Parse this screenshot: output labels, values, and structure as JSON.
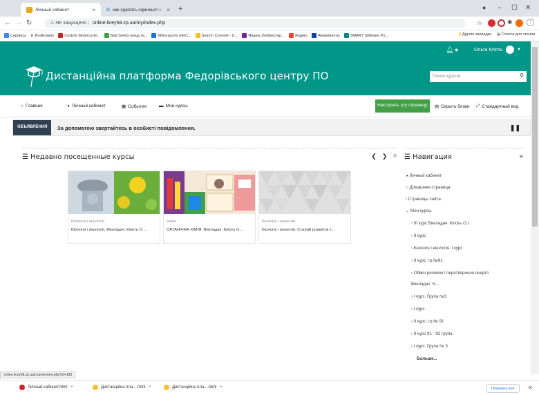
{
  "browser": {
    "tabs": [
      {
        "title": "Личный кабинет",
        "favicon_color": "#e5a823"
      },
      {
        "title": "как сделать скриншот на компь",
        "favicon_color": "#4285f4"
      }
    ],
    "address": {
      "security_label": "Не защищено",
      "url": "online.licey58.zp.ua/my/index.php"
    },
    "bookmarks": [
      {
        "label": "Сервисы",
        "color": "#4285f4"
      },
      {
        "label": "Bookmarks",
        "color": "#1e5bd6"
      },
      {
        "label": "Custom Motorcycle...",
        "color": "#c62828"
      },
      {
        "label": "Bad Seeds предста...",
        "color": "#43a047"
      },
      {
        "label": "Motorsports InfoC...",
        "color": "#1976d2"
      },
      {
        "label": "Search Console - C...",
        "color": "#fbc02d"
      },
      {
        "label": "Яндекс.Вебмастер...",
        "color": "#7b1fa2"
      },
      {
        "label": "Яндекс",
        "color": "#f44336"
      },
      {
        "label": "Авиабилеты",
        "color": "#0d47a1"
      },
      {
        "label": "SMART Software Po...",
        "color": "#00897b"
      }
    ],
    "bookmarks_right": [
      "Другие закладки",
      "Список для чтения"
    ],
    "status_url": "online.licey58.zp.ua/course/view.php?id=183",
    "downloads": [
      "Личный кабинет.html",
      "Дистанційна пла....html",
      "Дистанційна пла....html"
    ],
    "show_all_label": "Показать все"
  },
  "moodle": {
    "user_name": "Ольга Кіпоть",
    "site_name": "Дистанційна платформа Федорівського центру ПО",
    "search_placeholder": "Поиск курсов",
    "menu": [
      "Главная",
      "Личный кабинет",
      "События",
      "Мои курсы"
    ],
    "customise_label": "Настроить эту страницу",
    "hide_blocks_label": "Скрыть блоки",
    "standard_view_label": "Стандартный вид",
    "notice_label": "ОБЪЯВЛЕНИЯ",
    "notice_text": "За допомогою звертайтесь в особисті повідомлення.",
    "recent_title": "Недавно посещенные курсы",
    "courses": [
      {
        "category": "Біологія і екологія",
        "name": "Біологія і екологія. Викладач: Кіпоть О..."
      },
      {
        "category": "Хімія",
        "name": "ОРГАНІЧНА ХІМІЯ. Викладач: Кіпоть О..."
      },
      {
        "category": "Біологія і екологія",
        "name": "Біологія і екологія. Сталий розвиток т..."
      }
    ],
    "nav_title": "Навигация",
    "nav_items": [
      {
        "label": "Личный кабинет",
        "prefix": "⌂"
      },
      {
        "label": "Домашняя страница",
        "prefix": "⌂"
      },
      {
        "label": "Страницы сайта",
        "prefix": "›"
      },
      {
        "label": "Мои курсы",
        "prefix": "⌄"
      },
      {
        "label": "III курс Викладач: Кіпоть О.І.",
        "prefix": "›"
      },
      {
        "label": "II курс",
        "prefix": "›"
      },
      {
        "label": "Біологія і екологія. I курс",
        "prefix": "›"
      },
      {
        "label": "II курс. гр.№91",
        "prefix": "›"
      },
      {
        "label": "Обмін речовин і перетворення енергії.",
        "prefix": "›"
      },
      {
        "label": "Викладач: К...",
        "prefix": ""
      },
      {
        "label": "I курс. Група №3",
        "prefix": "›"
      },
      {
        "label": "I курс",
        "prefix": "›"
      },
      {
        "label": "II курс. гр.№ 91",
        "prefix": "›"
      },
      {
        "label": "II курс 91 - 92 група",
        "prefix": "›"
      },
      {
        "label": "I курс. Група № 3",
        "prefix": "›"
      },
      {
        "label": "Больше...",
        "prefix": ""
      }
    ]
  }
}
